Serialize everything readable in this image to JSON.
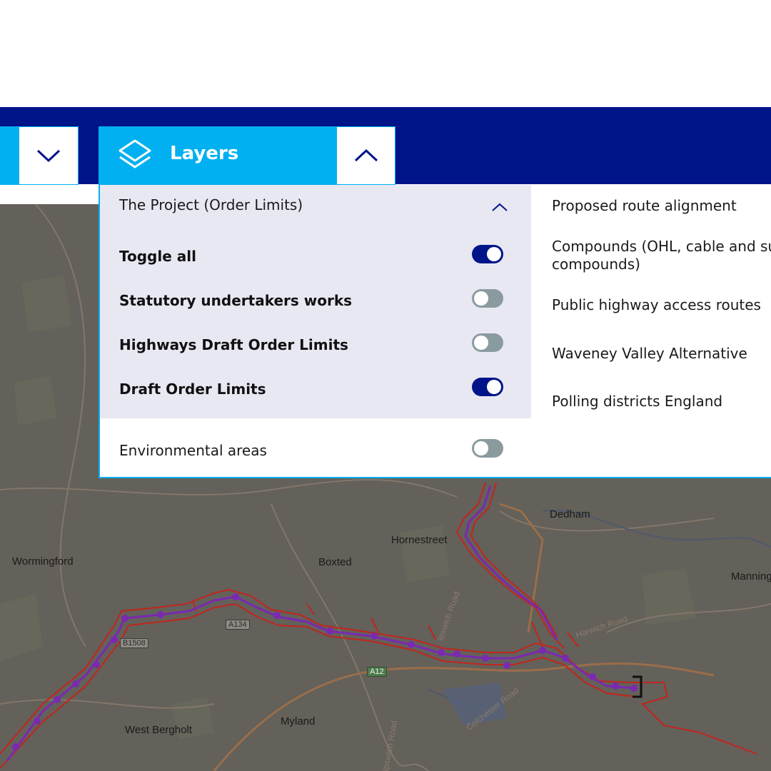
{
  "header": {
    "layers_label": "Layers"
  },
  "panel": {
    "group_title": "The Project (Order Limits)",
    "layers": [
      {
        "label": "Toggle all",
        "on": true
      },
      {
        "label": "Statutory undertakers works",
        "on": false
      },
      {
        "label": "Highways Draft Order Limits",
        "on": false
      },
      {
        "label": "Draft Order Limits",
        "on": true
      }
    ],
    "environmental": {
      "label": "Environmental areas",
      "on": false
    },
    "side_items": [
      "Proposed route alignment",
      "Compounds (OHL, cable and sub",
      "compounds)",
      "Public highway access routes",
      "Waveney Valley Alternative",
      "Polling districts England"
    ]
  },
  "map": {
    "places": [
      "Dedham",
      "Hornestreet",
      "Wormingford",
      "Boxted",
      "Manning",
      "West Bergholt",
      "Myland"
    ],
    "roads": [
      "A134",
      "B1508",
      "A12",
      "Harwich Road",
      "Colchester Road",
      "Ipswich Road",
      "Ipswich Road"
    ]
  },
  "colors": {
    "header_bg": "#001489",
    "accent": "#00b0f0",
    "toggle_on": "#001489",
    "toggle_off": "#8a9b9f",
    "group_bg": "#e8e8f3",
    "route": "#7a2ab0",
    "order_limits": "#c0261e"
  }
}
